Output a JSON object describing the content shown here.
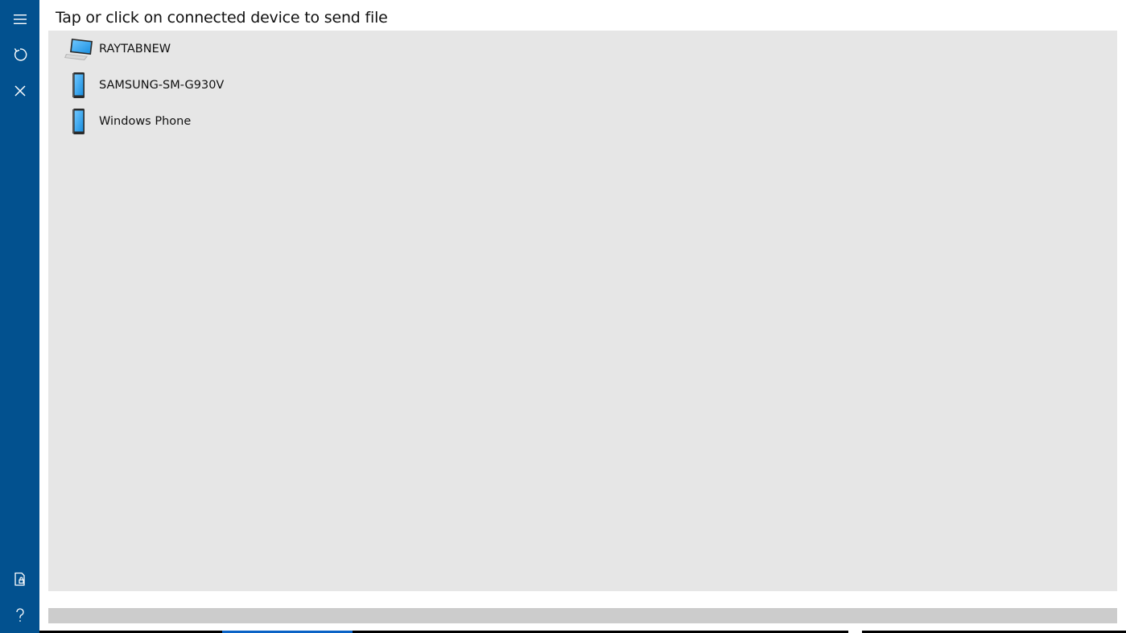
{
  "header": {
    "title": "Tap or click on connected device to send file"
  },
  "rail": {
    "top_buttons": [
      {
        "name": "menu",
        "icon": "hamburger-icon"
      },
      {
        "name": "refresh",
        "icon": "refresh-icon"
      },
      {
        "name": "close",
        "icon": "close-icon"
      }
    ],
    "bottom_buttons": [
      {
        "name": "file",
        "icon": "document-lock-icon"
      },
      {
        "name": "help",
        "icon": "question-icon"
      }
    ]
  },
  "devices": [
    {
      "label": "RAYTABNEW",
      "icon": "laptop-icon"
    },
    {
      "label": "SAMSUNG-SM-G930V",
      "icon": "phone-icon"
    },
    {
      "label": "Windows Phone",
      "icon": "phone-icon"
    }
  ],
  "progress": {
    "value": 0
  },
  "colors": {
    "rail": "#02518f",
    "panel": "#e6e6e6",
    "progress_track": "#cccccc",
    "accent": "#0a63c6"
  }
}
